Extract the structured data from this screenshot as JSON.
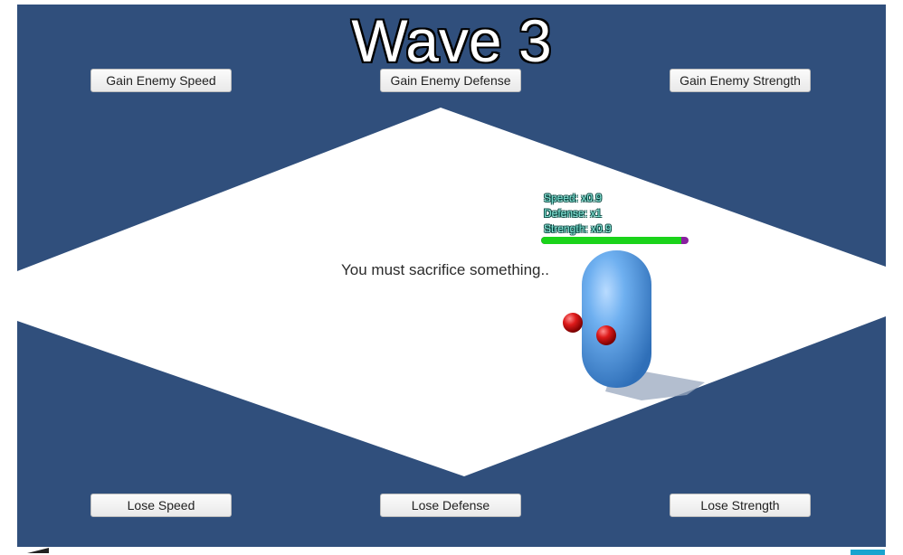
{
  "title": "Wave 3",
  "buttons": {
    "gain_speed": "Gain Enemy Speed",
    "gain_defense": "Gain Enemy Defense",
    "gain_strength": "Gain Enemy Strength",
    "lose_speed": "Lose Speed",
    "lose_defense": "Lose Defense",
    "lose_strength": "Lose Strength"
  },
  "message": "You must sacrifice something..",
  "enemy": {
    "speed": "Speed: x0.9",
    "defense": "Defense: x1",
    "strength": "Strength: x0.9",
    "health_fraction": 0.95
  },
  "colors": {
    "background": "#304f7c",
    "floor": "#ffffff",
    "player": "#4f93d8",
    "enemy": "#cc1111",
    "health": "#1ad31a",
    "health_back": "#8a1fa0"
  }
}
